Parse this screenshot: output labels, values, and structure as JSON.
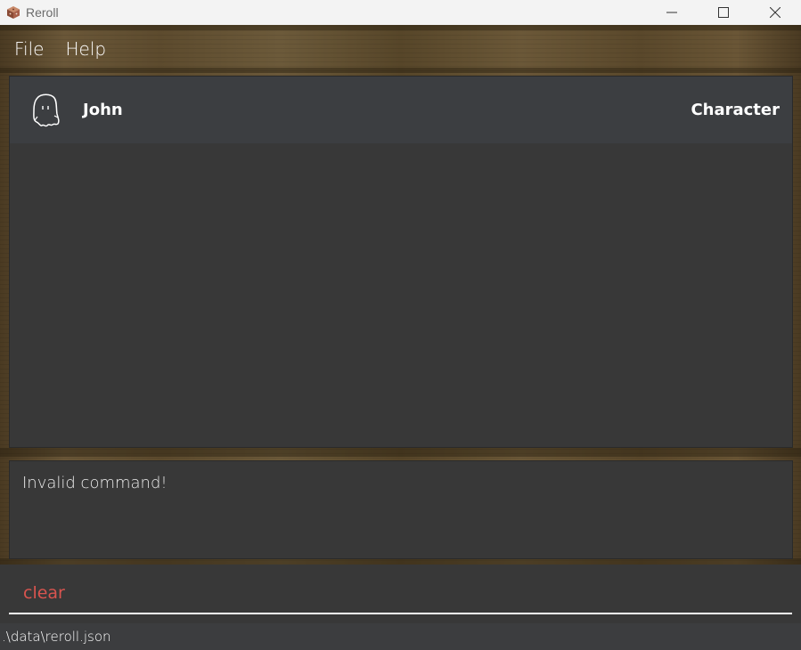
{
  "window": {
    "title": "Reroll",
    "app_icon": "reroll-dice-icon"
  },
  "window_controls": {
    "minimize_icon": "minimize-icon",
    "maximize_icon": "maximize-icon",
    "close_icon": "close-icon"
  },
  "menu": {
    "items": [
      {
        "label": "File"
      },
      {
        "label": "Help"
      }
    ]
  },
  "entity_list": {
    "items": [
      {
        "icon": "ghost-icon",
        "name": "John",
        "type": "Character"
      }
    ]
  },
  "result_display": {
    "message": "Invalid command!"
  },
  "command_box": {
    "value": "clear",
    "text_color": "#d9544f"
  },
  "status_bar": {
    "file_path": ".\\data\\reroll.json"
  },
  "colors": {
    "panel_bg": "#383838",
    "list_item_bg": "#3c3e41",
    "title_bar_bg": "#f3f3f3"
  }
}
